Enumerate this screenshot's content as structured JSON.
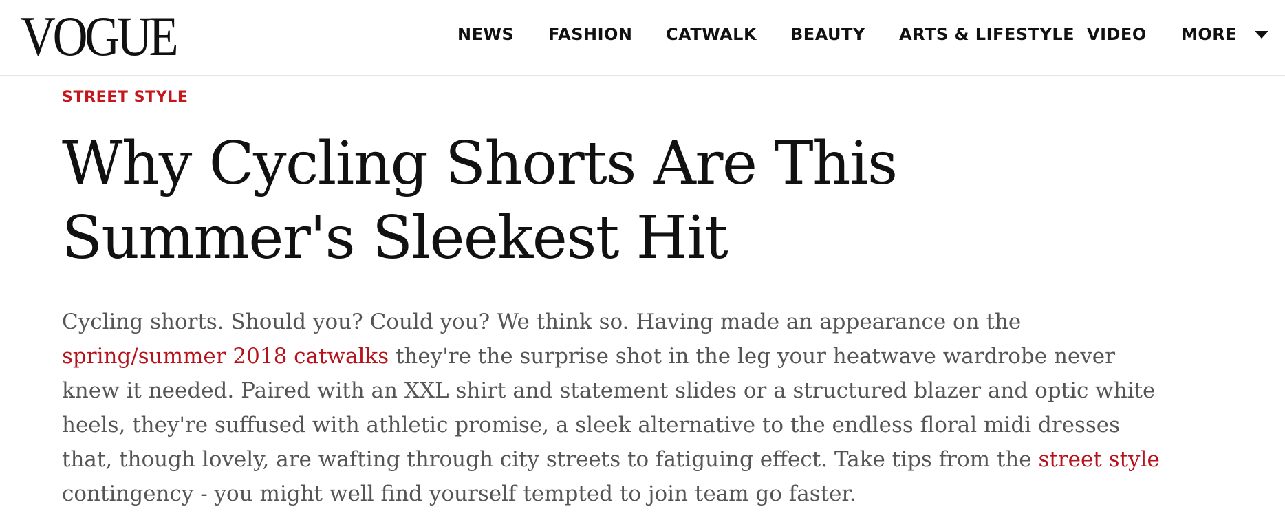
{
  "header": {
    "logo": "VOGUE",
    "nav": [
      {
        "label": "NEWS"
      },
      {
        "label": "FASHION"
      },
      {
        "label": "CATWALK"
      },
      {
        "label": "BEAUTY"
      },
      {
        "label": "ARTS & LIFESTYLE"
      },
      {
        "label": "VIDEO"
      },
      {
        "label": "MORE",
        "icon": "chevron-down-icon"
      }
    ]
  },
  "article": {
    "kicker": "STREET STYLE",
    "headline_line1": "Why Cycling Shorts Are This",
    "headline_line2": "Summer's Sleekest Hit",
    "body": {
      "p1": "Cycling shorts. Should you? Could you? We think so. Having made an appearance on the ",
      "link1": "spring/summer 2018 catwalks",
      "p2": " they're the surprise shot in the leg your heatwave wardrobe never knew it needed. Paired with an XXL shirt and statement slides or a structured blazer and optic white heels, they're suffused with athletic promise, a sleek alternative to the endless floral midi dresses that, though lovely, are wafting through city streets to fatiguing effect. Take tips from the ",
      "link2": "street style",
      "p3": " contingency - you might well find yourself tempted to join team go faster."
    }
  },
  "colors": {
    "accent_red": "#c4161c",
    "link_red": "#b5121b",
    "body_gray": "#555555",
    "text_black": "#111111"
  }
}
